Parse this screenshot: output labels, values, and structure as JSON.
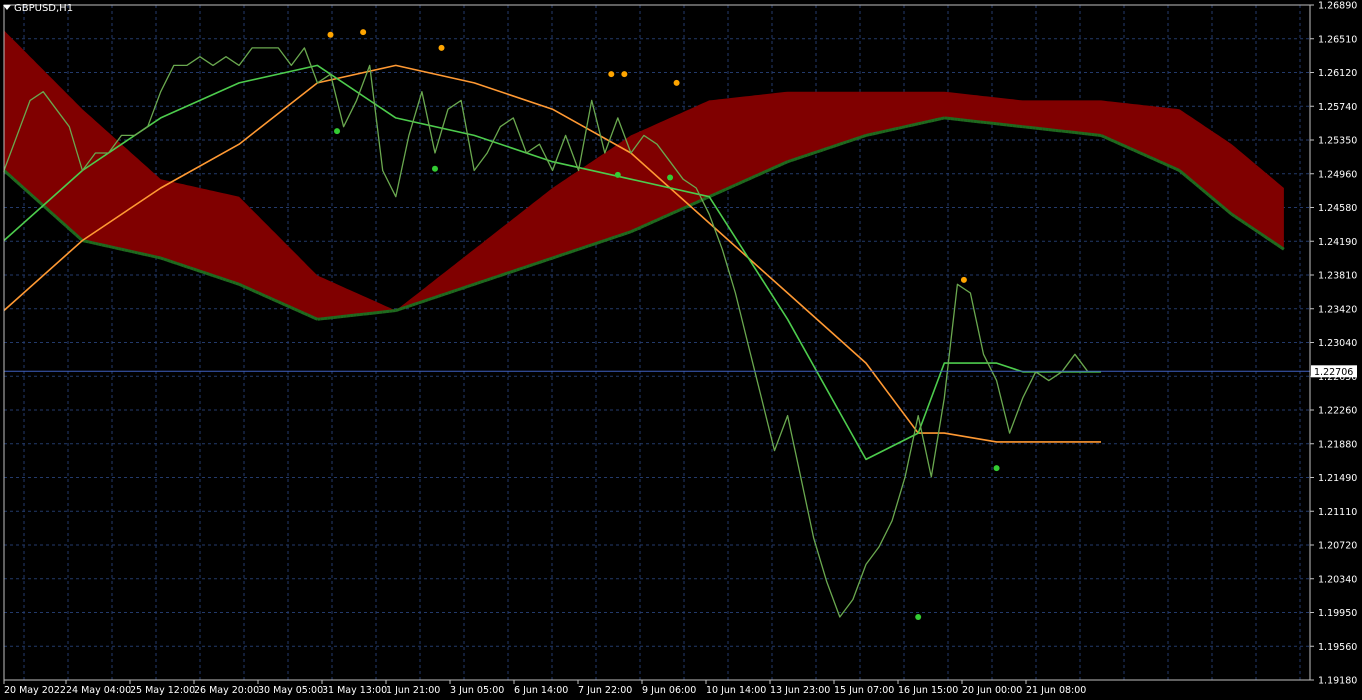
{
  "window": {
    "symbol_label": "GBPUSD,H1"
  },
  "colors": {
    "background": "#000000",
    "grid": "#233a6b",
    "axis": "#c0c0c0",
    "text": "#ffffff",
    "price_bars": "#6aa84f",
    "cloud_bearish": "#800000",
    "cloud_bullish": "#006400",
    "span_b_bullish": "#8b1a1a",
    "span_b_bearish": "#1f6b1f",
    "kijun_orange": "#ff9933",
    "tenkan_green": "#4dcc4d",
    "fractal_up": "#ffa500",
    "fractal_down": "#33cc33",
    "current_price_line": "#4060c0"
  },
  "chart_data": {
    "type": "line",
    "title": "",
    "symbol": "GBPUSD",
    "timeframe": "H1",
    "ylim": [
      1.1918,
      1.2689
    ],
    "y_ticks": [
      "1.26890",
      "1.26510",
      "1.26120",
      "1.25740",
      "1.25350",
      "1.24960",
      "1.24580",
      "1.24190",
      "1.23810",
      "1.23420",
      "1.23040",
      "1.22650",
      "1.22260",
      "1.21880",
      "1.21490",
      "1.21110",
      "1.20720",
      "1.20340",
      "1.19950",
      "1.19560",
      "1.19180"
    ],
    "x_ticks": [
      "20 May 2022",
      "24 May 04:00",
      "25 May 12:00",
      "26 May 20:00",
      "30 May 05:00",
      "31 May 13:00",
      "1 Jun 21:00",
      "3 Jun 05:00",
      "6 Jun 14:00",
      "7 Jun 22:00",
      "9 Jun 06:00",
      "10 Jun 14:00",
      "13 Jun 23:00",
      "15 Jun 07:00",
      "16 Jun 15:00",
      "20 Jun 00:00",
      "21 Jun 08:00"
    ],
    "current_price": "1.22706",
    "grid": true,
    "x_index_range": [
      0,
      100
    ],
    "series": [
      {
        "role": "price",
        "x": [
          0,
          2,
          3,
          4,
          5,
          6,
          7,
          8,
          9,
          10,
          11,
          12,
          13,
          14,
          15,
          16,
          17,
          18,
          19,
          20,
          21,
          22,
          23,
          24,
          25,
          26,
          27,
          28,
          29,
          30,
          31,
          32,
          33,
          34,
          35,
          36,
          37,
          38,
          39,
          40,
          41,
          42,
          43,
          44,
          45,
          46,
          47,
          48,
          49,
          50,
          51,
          52,
          53,
          54,
          55,
          56,
          57,
          58,
          59,
          60,
          61,
          62,
          63,
          64,
          65,
          66,
          67,
          68,
          69,
          70,
          71,
          72,
          73,
          74,
          75,
          76,
          77,
          78,
          79,
          80,
          81,
          82,
          83
        ],
        "values": [
          1.25,
          1.258,
          1.259,
          1.257,
          1.255,
          1.25,
          1.252,
          1.252,
          1.254,
          1.254,
          1.255,
          1.259,
          1.262,
          1.262,
          1.263,
          1.262,
          1.263,
          1.262,
          1.264,
          1.264,
          1.264,
          1.262,
          1.264,
          1.26,
          1.261,
          1.255,
          1.258,
          1.262,
          1.25,
          1.247,
          1.254,
          1.259,
          1.252,
          1.257,
          1.258,
          1.25,
          1.252,
          1.255,
          1.256,
          1.252,
          1.253,
          1.25,
          1.254,
          1.25,
          1.258,
          1.252,
          1.256,
          1.252,
          1.254,
          1.253,
          1.251,
          1.249,
          1.248,
          1.245,
          1.241,
          1.236,
          1.23,
          1.224,
          1.218,
          1.222,
          1.215,
          1.208,
          1.203,
          1.199,
          1.201,
          1.205,
          1.207,
          1.21,
          1.215,
          1.222,
          1.215,
          1.224,
          1.237,
          1.236,
          1.229,
          1.226,
          1.22,
          1.224,
          1.227,
          1.226,
          1.227,
          1.229,
          1.227
        ]
      },
      {
        "role": "tenkan",
        "x": [
          0,
          6,
          12,
          18,
          24,
          30,
          36,
          42,
          48,
          54,
          60,
          66,
          70,
          72,
          76,
          78,
          84
        ],
        "values": [
          1.242,
          1.25,
          1.256,
          1.26,
          1.262,
          1.256,
          1.254,
          1.251,
          1.249,
          1.247,
          1.233,
          1.217,
          1.22,
          1.228,
          1.228,
          1.227,
          1.227
        ]
      },
      {
        "role": "kijun",
        "x": [
          0,
          6,
          12,
          18,
          24,
          30,
          36,
          42,
          48,
          54,
          60,
          66,
          70,
          72,
          76,
          78,
          84
        ],
        "values": [
          1.234,
          1.242,
          1.248,
          1.253,
          1.26,
          1.262,
          1.26,
          1.257,
          1.252,
          1.244,
          1.236,
          1.228,
          1.22,
          1.22,
          1.219,
          1.219,
          1.219
        ]
      },
      {
        "role": "span_a",
        "x": [
          0,
          6,
          12,
          18,
          24,
          30,
          36,
          42,
          48,
          54,
          60,
          66,
          72,
          78,
          84,
          90,
          94,
          98
        ],
        "values": [
          1.266,
          1.257,
          1.249,
          1.247,
          1.238,
          1.234,
          1.241,
          1.248,
          1.254,
          1.258,
          1.259,
          1.259,
          1.259,
          1.258,
          1.258,
          1.257,
          1.253,
          1.248
        ]
      },
      {
        "role": "span_b",
        "x": [
          0,
          6,
          12,
          18,
          24,
          30,
          36,
          42,
          48,
          54,
          60,
          66,
          72,
          78,
          84,
          90,
          94,
          98
        ],
        "values": [
          1.25,
          1.242,
          1.24,
          1.237,
          1.233,
          1.234,
          1.237,
          1.24,
          1.243,
          1.247,
          1.251,
          1.254,
          1.256,
          1.255,
          1.254,
          1.25,
          1.245,
          1.241
        ]
      }
    ],
    "fractals_up": [
      {
        "x": 25,
        "y": 1.2655
      },
      {
        "x": 27.5,
        "y": 1.2658
      },
      {
        "x": 33.5,
        "y": 1.264
      },
      {
        "x": 46.5,
        "y": 1.261
      },
      {
        "x": 47.5,
        "y": 1.261
      },
      {
        "x": 51.5,
        "y": 1.26
      },
      {
        "x": 73.5,
        "y": 1.2375
      }
    ],
    "fractals_down": [
      {
        "x": 25.5,
        "y": 1.2545
      },
      {
        "x": 33,
        "y": 1.2502
      },
      {
        "x": 47,
        "y": 1.2495
      },
      {
        "x": 51,
        "y": 1.2492
      },
      {
        "x": 70,
        "y": 1.199
      },
      {
        "x": 76,
        "y": 1.216
      }
    ]
  }
}
